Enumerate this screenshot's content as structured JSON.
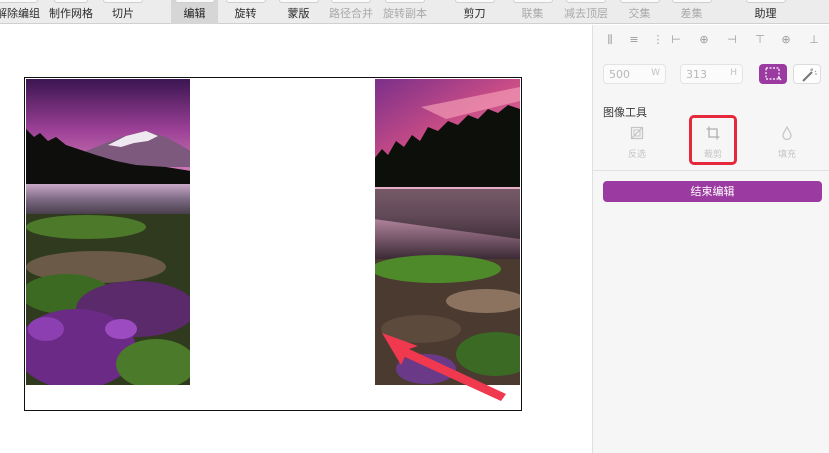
{
  "toolbar": {
    "items": [
      {
        "label": "解除编组",
        "state": "normal"
      },
      {
        "label": "制作网格",
        "state": "normal"
      },
      {
        "label": "切片",
        "state": "normal"
      },
      {
        "label": "编辑",
        "state": "active"
      },
      {
        "label": "旋转",
        "state": "normal"
      },
      {
        "label": "蒙版",
        "state": "normal"
      },
      {
        "label": "路径合并",
        "state": "disabled"
      },
      {
        "label": "旋转副本",
        "state": "disabled"
      },
      {
        "label": "剪刀",
        "state": "normal"
      },
      {
        "label": "联集",
        "state": "disabled"
      },
      {
        "label": "减去顶层",
        "state": "disabled"
      },
      {
        "label": "交集",
        "state": "disabled"
      },
      {
        "label": "差集",
        "state": "disabled"
      },
      {
        "label": "助理",
        "state": "normal"
      }
    ]
  },
  "inspector": {
    "width_value": "500",
    "width_unit": "W",
    "height_value": "313",
    "height_unit": "H",
    "image_tools": {
      "title": "图像工具",
      "items": [
        {
          "label": "反选",
          "icon": "invert-selection-icon"
        },
        {
          "label": "裁剪",
          "icon": "crop-icon"
        },
        {
          "label": "填充",
          "icon": "fill-drop-icon"
        }
      ]
    },
    "finish_button": "结束编辑",
    "accent_color": "#9b3aa0",
    "highlight_color": "#e5283b"
  },
  "annotation": {
    "arrow_color": "#f0384e"
  }
}
